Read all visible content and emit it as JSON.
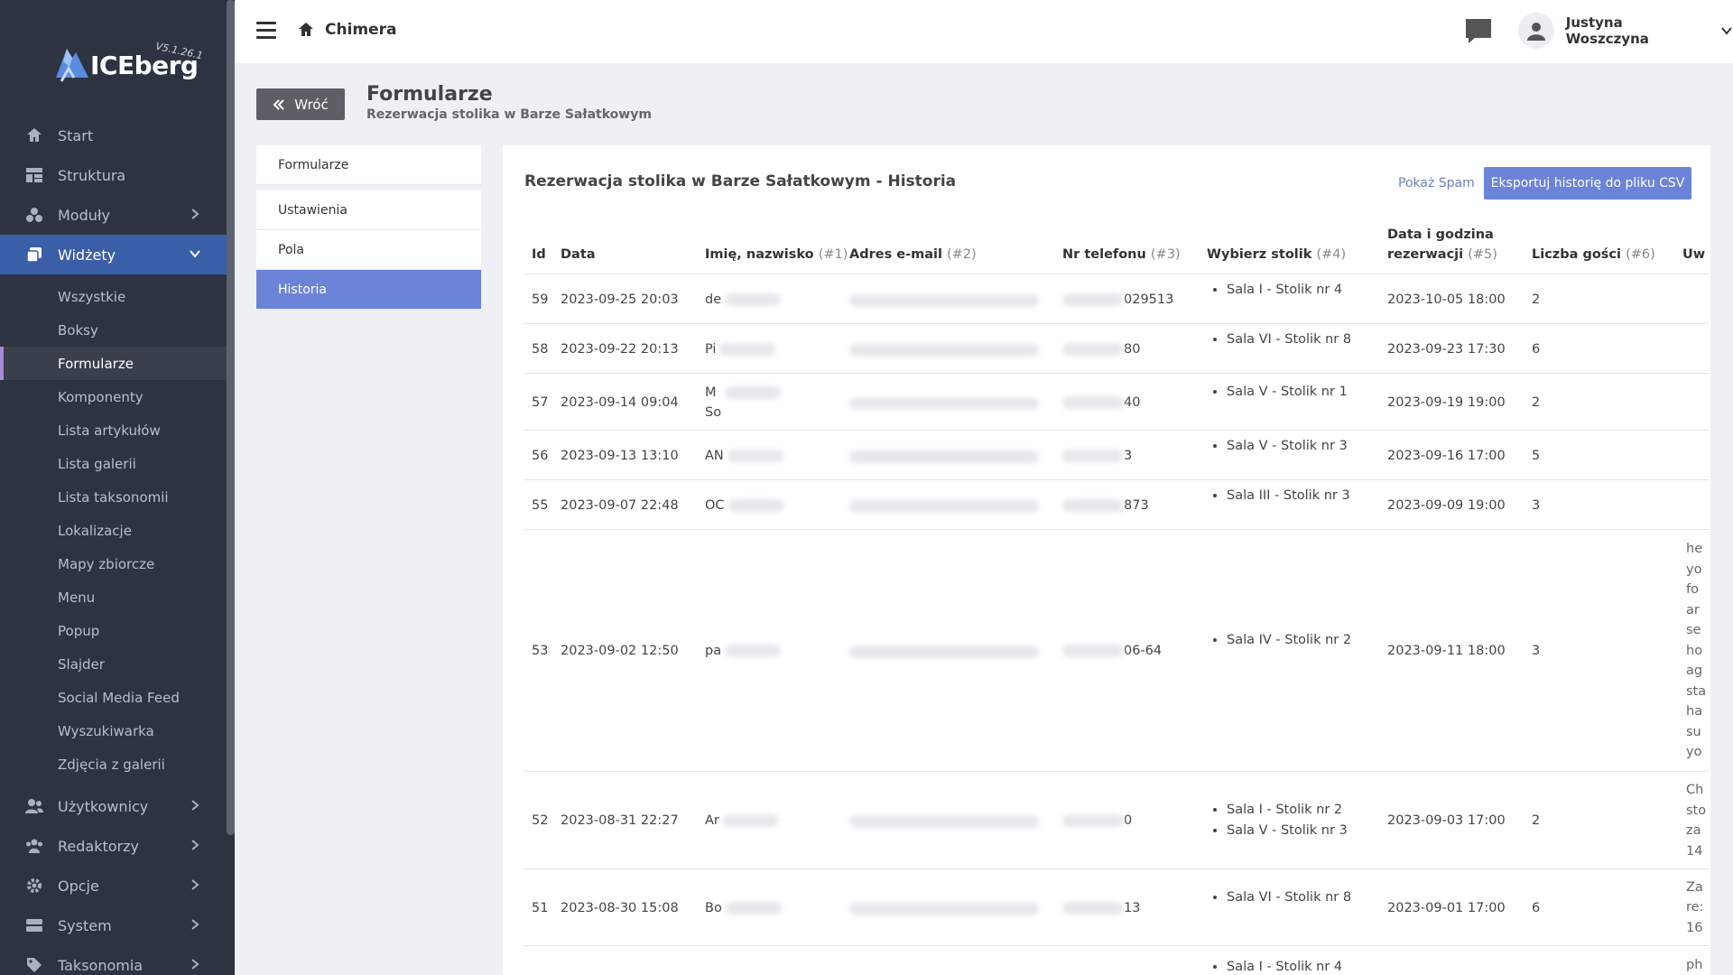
{
  "app": {
    "logo_text": "ICEberg",
    "version": "V5.1.26.1"
  },
  "sidebar": {
    "items": [
      {
        "label": "Start",
        "icon": "home-icon"
      },
      {
        "label": "Struktura",
        "icon": "structure-icon"
      },
      {
        "label": "Moduły",
        "icon": "modules-icon",
        "chevron": true
      },
      {
        "label": "Widżety",
        "icon": "widgets-icon",
        "expanded": true,
        "active": true
      }
    ],
    "subitems": [
      "Wszystkie",
      "Boksy",
      "Formularze",
      "Komponenty",
      "Lista artykułów",
      "Lista galerii",
      "Lista taksonomii",
      "Lokalizacje",
      "Mapy zbiorcze",
      "Menu",
      "Popup",
      "Slajder",
      "Social Media Feed",
      "Wyszukiwarka",
      "Zdjęcia z galerii"
    ],
    "active_subitem": "Formularze",
    "items_after": [
      {
        "label": "Użytkownicy",
        "icon": "users-icon"
      },
      {
        "label": "Redaktorzy",
        "icon": "editors-icon"
      },
      {
        "label": "Opcje",
        "icon": "gear-icon"
      },
      {
        "label": "System",
        "icon": "system-icon"
      },
      {
        "label": "Taksonomia",
        "icon": "tag-icon"
      }
    ]
  },
  "topbar": {
    "breadcrumb": "Chimera",
    "user_name": "Justyna Woszczyna"
  },
  "page": {
    "back_label": "Wróć",
    "title": "Formularze",
    "subtitle": "Rezerwacja stolika w Barze Sałatkowym"
  },
  "tabs": [
    "Formularze",
    "Ustawienia",
    "Pola",
    "Historia"
  ],
  "active_tab": "Historia",
  "card": {
    "title": "Rezerwacja stolika w Barze Sałatkowym - Historia",
    "spam_label": "Pokaż Spam",
    "export_label": "Eksportuj historię do pliku CSV"
  },
  "table": {
    "headers": [
      {
        "label": "Id",
        "num": ""
      },
      {
        "label": "Data",
        "num": ""
      },
      {
        "label": "Imię, nazwisko",
        "num": "(#1)"
      },
      {
        "label": "Adres e-mail",
        "num": "(#2)"
      },
      {
        "label": "Nr telefonu",
        "num": "(#3)"
      },
      {
        "label": "Wybierz stolik",
        "num": "(#4)"
      },
      {
        "label": "Data i godzina",
        "label2": "rezerwacji",
        "num": "(#5)"
      },
      {
        "label": "Liczba gości",
        "num": "(#6)"
      },
      {
        "label": "Uw",
        "num": ""
      }
    ],
    "rows": [
      {
        "id": "59",
        "date": "2023-09-25 20:03",
        "name": "de",
        "phone": "029513",
        "tables": [
          "Sala I - Stolik nr 4"
        ],
        "res": "2023-10-05 18:00",
        "guests": "2",
        "notes": []
      },
      {
        "id": "58",
        "date": "2023-09-22 20:13",
        "name": "Pi",
        "phone": "80",
        "tables": [
          "Sala VI - Stolik nr 8"
        ],
        "res": "2023-09-23 17:30",
        "guests": "6",
        "notes": []
      },
      {
        "id": "57",
        "date": "2023-09-14 09:04",
        "name": "M\nSo",
        "phone": "40",
        "tables": [
          "Sala V - Stolik nr 1"
        ],
        "res": "2023-09-19 19:00",
        "guests": "2",
        "notes": []
      },
      {
        "id": "56",
        "date": "2023-09-13 13:10",
        "name": "AN",
        "phone": "3",
        "tables": [
          "Sala V - Stolik nr 3"
        ],
        "res": "2023-09-16 17:00",
        "guests": "5",
        "notes": []
      },
      {
        "id": "55",
        "date": "2023-09-07 22:48",
        "name": "OC",
        "phone": "873",
        "tables": [
          "Sala III - Stolik nr 3"
        ],
        "res": "2023-09-09 19:00",
        "guests": "3",
        "notes": []
      },
      {
        "id": "53",
        "date": "2023-09-02 12:50",
        "name": "pa",
        "phone": "06-64",
        "tables": [
          "Sala IV - Stolik nr 2"
        ],
        "res": "2023-09-11 18:00",
        "guests": "3",
        "notes": [
          "he",
          "yo",
          "fo",
          "ar",
          "se",
          "ho",
          "ag",
          "sta",
          "ha",
          "su",
          "yo"
        ]
      },
      {
        "id": "52",
        "date": "2023-08-31 22:27",
        "name": "Ar",
        "phone": "0",
        "tables": [
          "Sala I - Stolik nr 2",
          "Sala V - Stolik nr 3"
        ],
        "res": "2023-09-03 17:00",
        "guests": "2",
        "notes": [
          "Ch",
          "sto",
          "za",
          "14"
        ]
      },
      {
        "id": "51",
        "date": "2023-08-30 15:08",
        "name": "Bo",
        "phone": "13",
        "tables": [
          "Sala VI - Stolik nr 8"
        ],
        "res": "2023-09-01 17:00",
        "guests": "6",
        "notes": [
          "Za",
          "re:",
          "16"
        ]
      },
      {
        "id": "",
        "date": "",
        "name": "",
        "phone": "",
        "tables": [
          "Sala I - Stolik nr 4"
        ],
        "res": "",
        "guests": "",
        "notes": [
          "ph"
        ]
      }
    ]
  }
}
